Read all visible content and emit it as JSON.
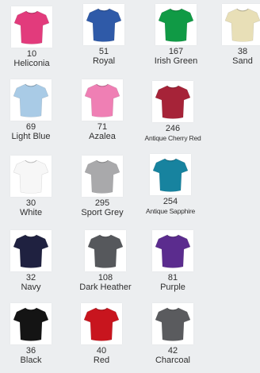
{
  "swatches": [
    {
      "code": "10",
      "name": "Heliconia",
      "color": "#e23b7c"
    },
    {
      "code": "51",
      "name": "Royal",
      "color": "#2f5aa8"
    },
    {
      "code": "167",
      "name": "Irish Green",
      "color": "#109a45"
    },
    {
      "code": "38",
      "name": "Sand",
      "color": "#e8dfb7"
    },
    {
      "code": "69",
      "name": "Light Blue",
      "color": "#a9cbe6"
    },
    {
      "code": "71",
      "name": "Azalea",
      "color": "#ef7fb4"
    },
    {
      "code": "246",
      "name": "Antique Cherry Red",
      "color": "#a62338"
    },
    {
      "code": "30",
      "name": "White",
      "color": "#f7f7f7"
    },
    {
      "code": "295",
      "name": "Sport Grey",
      "color": "#a9a9ab"
    },
    {
      "code": "254",
      "name": "Antique Sapphire",
      "color": "#17839f"
    },
    {
      "code": "32",
      "name": "Navy",
      "color": "#1f2140"
    },
    {
      "code": "108",
      "name": "Dark Heather",
      "color": "#56585c"
    },
    {
      "code": "81",
      "name": "Purple",
      "color": "#5b2c8e"
    },
    {
      "code": "36",
      "name": "Black",
      "color": "#141414"
    },
    {
      "code": "40",
      "name": "Red",
      "color": "#c8151e"
    },
    {
      "code": "42",
      "name": "Charcoal",
      "color": "#5a5b5e"
    }
  ]
}
